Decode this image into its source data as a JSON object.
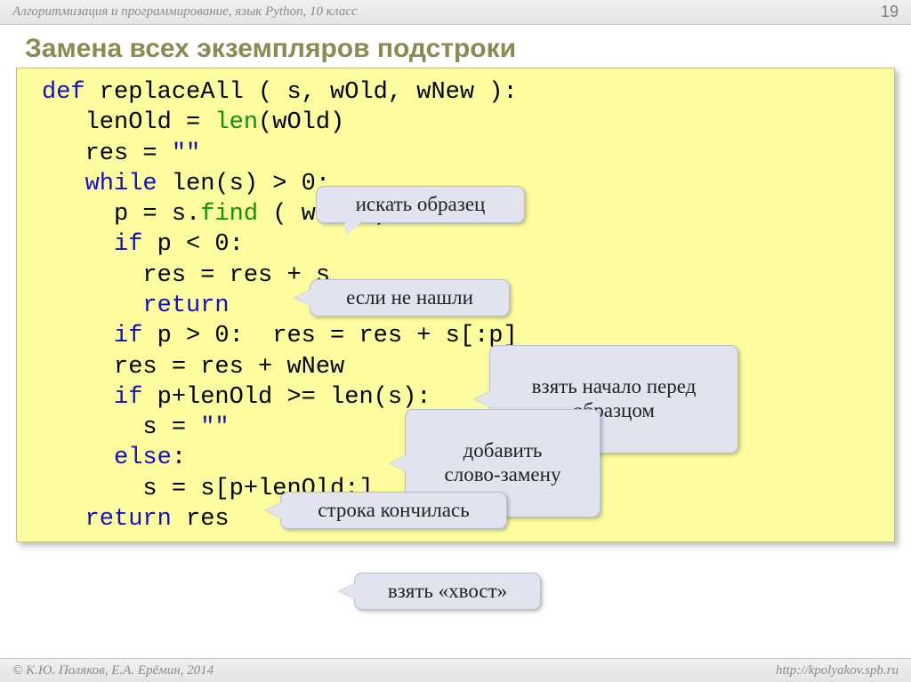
{
  "header": {
    "course": "Алгоритмизация и программирование, язык Python, 10 класс",
    "page": "19"
  },
  "title": "Замена всех экземпляров подстроки",
  "code": {
    "l1a": "def",
    "l1b": " replaceAll ( s, wOld, wNew ):",
    "l2a": "   lenOld = ",
    "l2b": "len",
    "l2c": "(wOld)",
    "l3a": "   res = ",
    "l3b": "\"\"",
    "l4a": "   while",
    "l4b": " len(s) > 0:",
    "l5a": "     p = s.",
    "l5b": "find",
    "l5c": " ( wOld )",
    "l6a": "     if",
    "l6b": " p < 0:",
    "l7": "       res = res + s",
    "l8a": "       return",
    "l9a": "     if",
    "l9b": " p > 0:  res = res + s[:p]",
    "l10": "     res = res + wNew",
    "l11a": "     if",
    "l11b": " p+lenOld >= len(s):",
    "l12a": "       s = ",
    "l12b": "\"\"",
    "l13a": "     else",
    "l13b": ":",
    "l14": "       s = s[p+lenOld:]",
    "l15a": "   return",
    "l15b": " res"
  },
  "callouts": {
    "c1": "искать образец",
    "c2": "если не нашли",
    "c3": "взять начало перед\nобразцом",
    "c4": "добавить\nслово-замену",
    "c5": "строка кончилась",
    "c6": "взять «хвост»"
  },
  "footer": {
    "copyright": "© К.Ю. Поляков, Е.А. Ерёмин, 2014",
    "url": "http://kpolyakov.spb.ru"
  }
}
